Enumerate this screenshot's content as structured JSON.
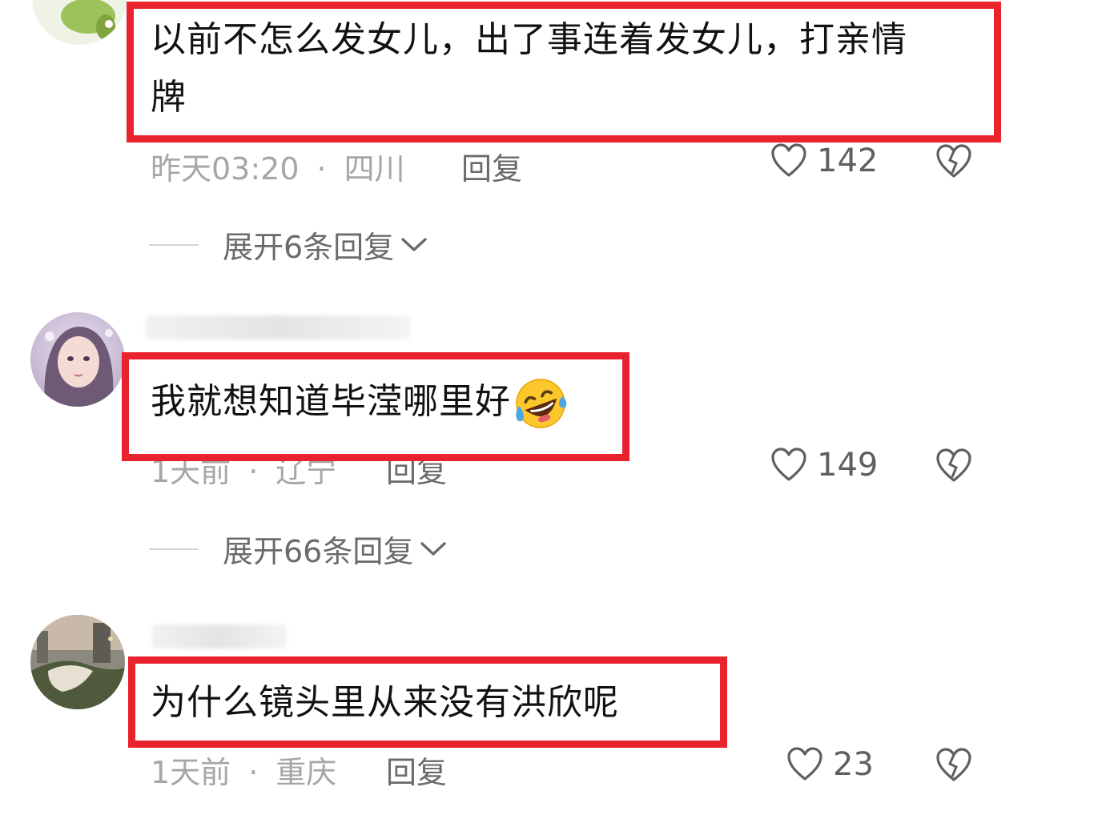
{
  "comments": [
    {
      "text_line1": "以前不怎么发女儿，出了事连着发女儿，打亲情",
      "text_line2": "牌",
      "time": "昨天03:20",
      "location": "四川",
      "reply": "回复",
      "likes": "142",
      "expand": "展开6条回复"
    },
    {
      "text": "我就想知道毕滢哪里好",
      "emoji": "rolling-on-floor-laughing",
      "time": "1天前",
      "location": "辽宁",
      "reply": "回复",
      "likes": "149",
      "expand": "展开66条回复"
    },
    {
      "text": "为什么镜头里从来没有洪欣呢",
      "time": "1天前",
      "location": "重庆",
      "reply": "回复",
      "likes": "23"
    }
  ],
  "colors": {
    "highlight": "#e8232d",
    "meta": "#a6a6a6",
    "action": "#6b6b6b"
  },
  "icons": [
    "heart-outline-icon",
    "broken-heart-icon",
    "chevron-down-icon"
  ]
}
